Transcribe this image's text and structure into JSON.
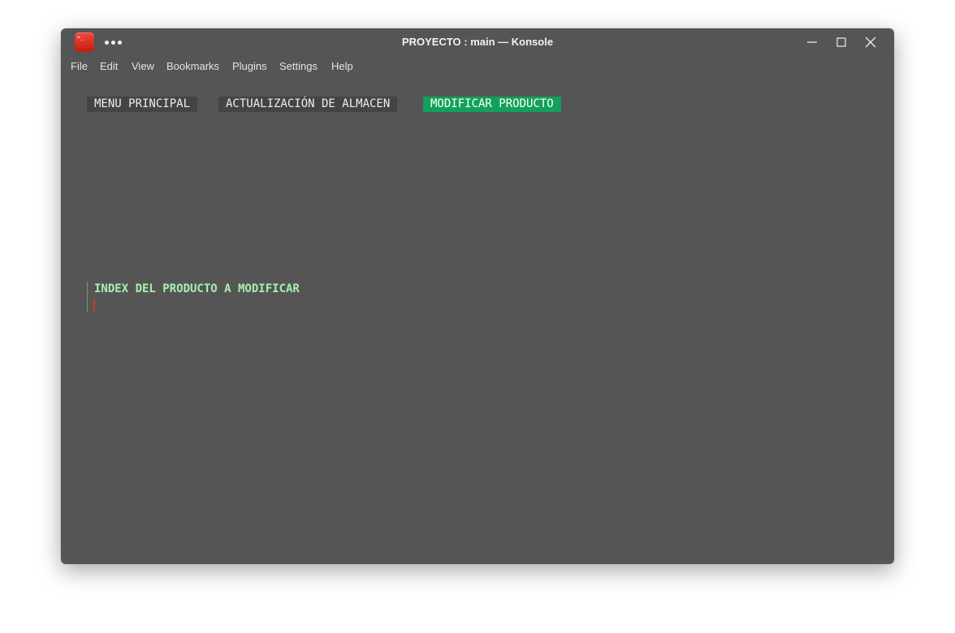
{
  "window": {
    "title": "PROYECTO : main — Konsole",
    "app_icon": "konsole-terminal-icon",
    "controls": [
      "minimize-icon",
      "maximize-icon",
      "close-icon"
    ]
  },
  "menubar": {
    "items": [
      "File",
      "Edit",
      "View",
      "Bookmarks",
      "Plugins",
      "Settings",
      "Help"
    ]
  },
  "terminal": {
    "breadcrumbs": [
      {
        "label": "MENU PRINCIPAL",
        "active": false
      },
      {
        "label": "ACTUALIZACIÓN DE ALMACEN",
        "active": false
      },
      {
        "label": "MODIFICAR PRODUCTO",
        "active": true
      }
    ],
    "prompt_label": "INDEX DEL PRODUCTO A MODIFICAR",
    "input_value": ""
  },
  "colors": {
    "background": "#555555",
    "active_breadcrumb": "#12a05a",
    "inactive_breadcrumb": "#444444",
    "prompt_text": "#a7f0b0",
    "cursor": "#d23a2a",
    "app_icon": "#e0352a"
  }
}
